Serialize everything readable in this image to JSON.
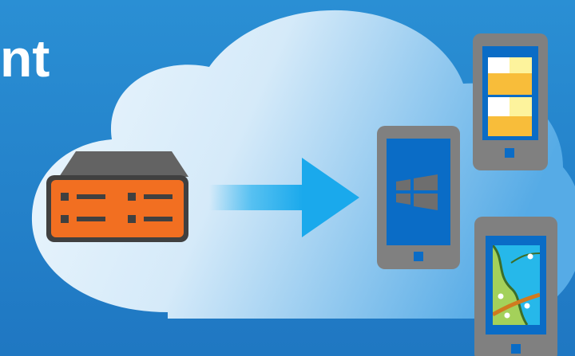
{
  "headline": "nt",
  "colors": {
    "background_top": "#2a8fd4",
    "background_bottom": "#1f77c2",
    "cloud_light": "#e9f4fc",
    "cloud_dark": "#3f9de0",
    "server_body": "#f26f21",
    "server_dark": "#404040",
    "device_frame": "#808080",
    "screen_blue": "#0a6cc6",
    "arrow": "#27b2ef",
    "tile_yellow_light": "#fdf39c",
    "tile_yellow_dark": "#f8bd3a",
    "map_green": "#a4d15a",
    "map_river": "#26b8ea",
    "map_road": "#d07a1f"
  },
  "icons": [
    "cloud-icon",
    "server-icon",
    "arrow-right-icon",
    "windows-logo-icon",
    "tiles-phone-icon",
    "map-phone-icon"
  ]
}
